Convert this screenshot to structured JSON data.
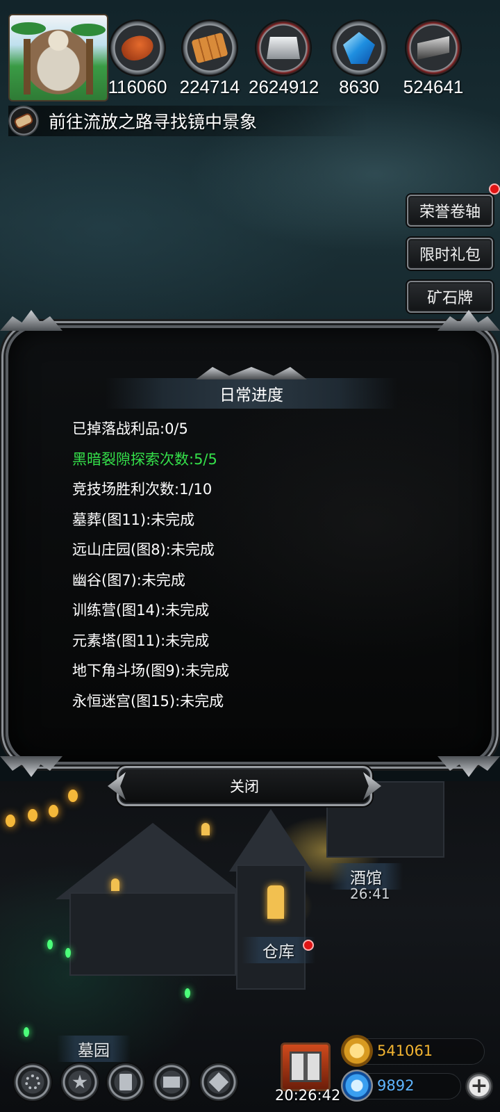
{
  "hud": {
    "resources": [
      {
        "icon": "meat-icon",
        "value": "116060"
      },
      {
        "icon": "wood-icon",
        "value": "224714"
      },
      {
        "icon": "iron-icon",
        "value": "2624912"
      },
      {
        "icon": "crystal-icon",
        "value": "8630"
      },
      {
        "icon": "steel-icon",
        "value": "524641"
      }
    ],
    "quest_text": "前往流放之路寻找镜中景象"
  },
  "side_menu": {
    "items": [
      "荣誉卷轴",
      "限时礼包",
      "矿石牌"
    ]
  },
  "modal": {
    "title": "日常进度",
    "items": [
      {
        "text": "已掉落战利品:0/5",
        "status": "normal"
      },
      {
        "text": "黑暗裂隙探索次数:5/5",
        "status": "done"
      },
      {
        "text": "竞技场胜利次数:1/10",
        "status": "normal"
      },
      {
        "text": "墓葬(图11):未完成",
        "status": "normal"
      },
      {
        "text": "远山庄园(图8):未完成",
        "status": "normal"
      },
      {
        "text": "幽谷(图7):未完成",
        "status": "normal"
      },
      {
        "text": "训练营(图14):未完成",
        "status": "normal"
      },
      {
        "text": "元素塔(图11):未完成",
        "status": "normal"
      },
      {
        "text": "地下角斗场(图9):未完成",
        "status": "normal"
      },
      {
        "text": "永恒迷宫(图15):未完成",
        "status": "normal"
      }
    ],
    "close_label": "关闭"
  },
  "town": {
    "tavern_label": "酒馆",
    "tavern_timer": "26:41",
    "warehouse_label": "仓库",
    "graveyard_label": "墓园"
  },
  "bottom_bar": {
    "buttons": [
      "settings-icon",
      "star-icon",
      "codex-icon",
      "mail-icon",
      "shop-icon"
    ],
    "clock": "20:26:42",
    "gold": "541061",
    "gems": "9892",
    "plus": "+"
  },
  "colors": {
    "done_text": "#35e04a",
    "red_dot": "#e01414",
    "gold_text": "#f2b431",
    "gem_text": "#5fb6ff"
  }
}
